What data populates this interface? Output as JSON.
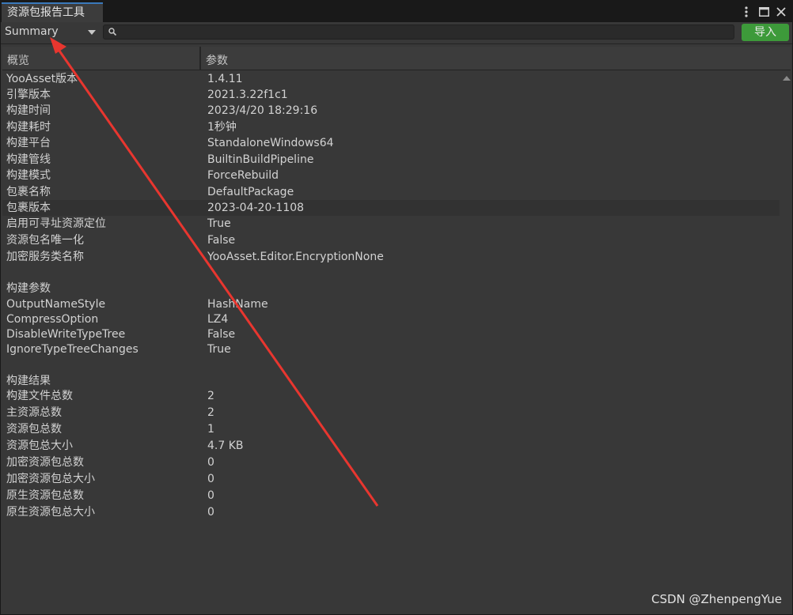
{
  "window": {
    "tab_title": "资源包报告工具",
    "icons": [
      "more-vert-icon",
      "maximize-icon",
      "close-icon"
    ]
  },
  "toolbar": {
    "view_select": "Summary",
    "search_placeholder": "",
    "import_label": "导入"
  },
  "table": {
    "col_overview": "概览",
    "col_params": "参数"
  },
  "rows": [
    {
      "k": "YooAsset版本",
      "v": "1.4.11"
    },
    {
      "k": "引擎版本",
      "v": "2021.3.22f1c1"
    },
    {
      "k": "构建时间",
      "v": "2023/4/20 18:29:16"
    },
    {
      "k": "构建耗时",
      "v": "1秒钟"
    },
    {
      "k": "构建平台",
      "v": "StandaloneWindows64"
    },
    {
      "k": "构建管线",
      "v": "BuiltinBuildPipeline"
    },
    {
      "k": "构建模式",
      "v": "ForceRebuild"
    },
    {
      "k": "包裹名称",
      "v": "DefaultPackage"
    },
    {
      "k": "包裹版本",
      "v": "2023-04-20-1108"
    },
    {
      "k": "启用可寻址资源定位",
      "v": "True"
    },
    {
      "k": "资源包名唯一化",
      "v": "False"
    },
    {
      "k": "加密服务类名称",
      "v": "YooAsset.Editor.EncryptionNone"
    },
    {
      "k": "构建参数",
      "v": ""
    },
    {
      "k": "OutputNameStyle",
      "v": "HashName"
    },
    {
      "k": "CompressOption",
      "v": "LZ4"
    },
    {
      "k": "DisableWriteTypeTree",
      "v": "False"
    },
    {
      "k": "IgnoreTypeTreeChanges",
      "v": "True"
    },
    {
      "k": "构建结果",
      "v": ""
    },
    {
      "k": "构建文件总数",
      "v": "2"
    },
    {
      "k": "主资源总数",
      "v": "2"
    },
    {
      "k": "资源包总数",
      "v": "1"
    },
    {
      "k": "资源包总大小",
      "v": "4.7 KB"
    },
    {
      "k": "加密资源包总数",
      "v": "0"
    },
    {
      "k": "加密资源包总大小",
      "v": "0"
    },
    {
      "k": "原生资源包总数",
      "v": "0"
    },
    {
      "k": "原生资源包总大小",
      "v": "0"
    }
  ],
  "watermark": "CSDN @ZhenpengYue",
  "colors": {
    "accent": "#3a79bb",
    "import_button": "#3d9a3a",
    "annotation_arrow": "#e8362f"
  }
}
